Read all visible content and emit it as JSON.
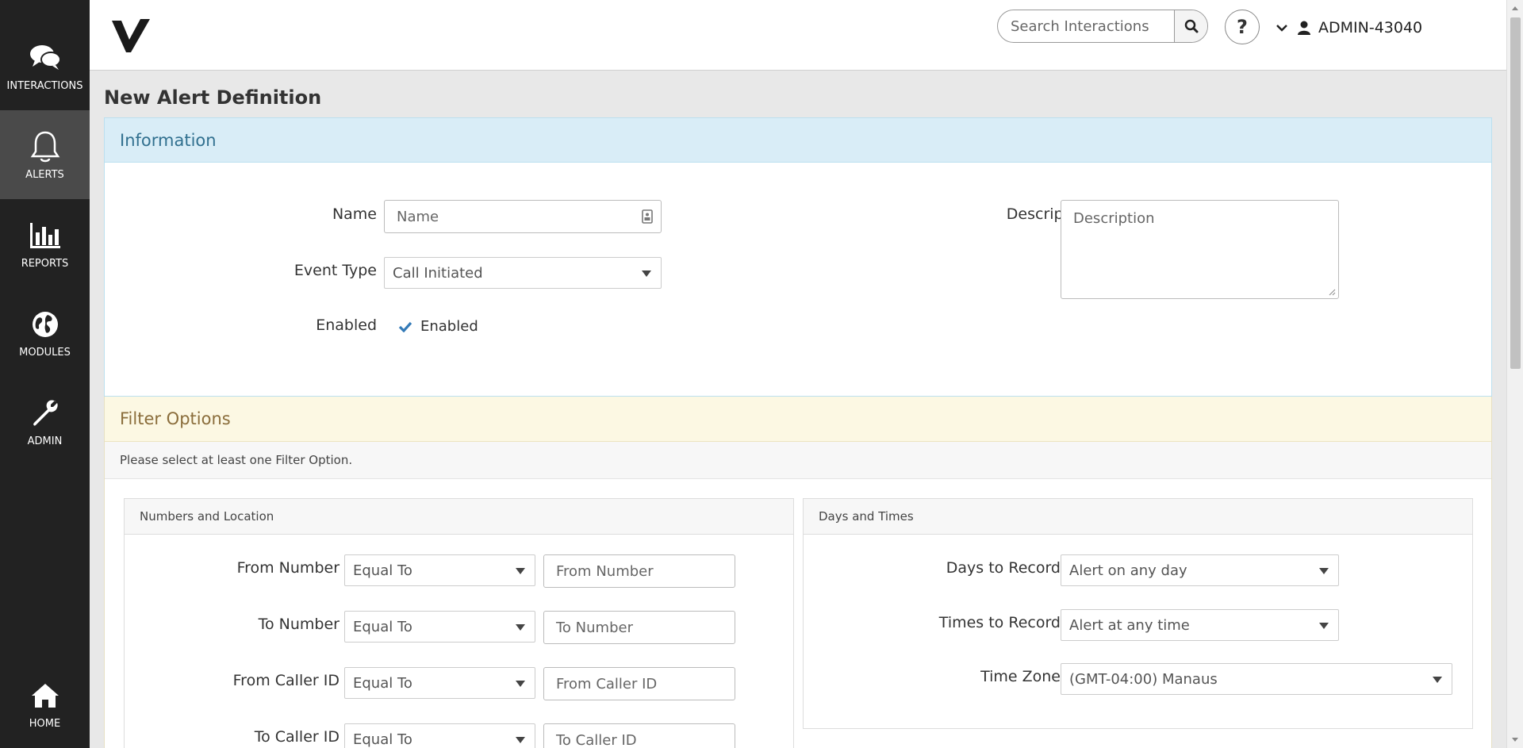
{
  "nav": {
    "interactions": "INTERACTIONS",
    "alerts": "ALERTS",
    "reports": "REPORTS",
    "modules": "MODULES",
    "admin": "ADMIN",
    "home": "HOME"
  },
  "header": {
    "search_placeholder": "Search Interactions",
    "help": "?",
    "user": "ADMIN-43040"
  },
  "page": {
    "title": "New Alert Definition"
  },
  "information": {
    "heading": "Information",
    "name_label": "Name",
    "name_placeholder": "Name",
    "event_type_label": "Event Type",
    "event_type_value": "Call Initiated",
    "enabled_label": "Enabled",
    "enabled_value": "Enabled",
    "description_label": "Description",
    "description_placeholder": "Description"
  },
  "filter": {
    "heading": "Filter Options",
    "note": "Please select at least one Filter Option.",
    "numbers": {
      "heading": "Numbers and Location",
      "rows": [
        {
          "label": "From Number",
          "operator": "Equal To",
          "placeholder": "From Number"
        },
        {
          "label": "To Number",
          "operator": "Equal To",
          "placeholder": "To Number"
        },
        {
          "label": "From Caller ID",
          "operator": "Equal To",
          "placeholder": "From Caller ID"
        },
        {
          "label": "To Caller ID",
          "operator": "Equal To",
          "placeholder": "To Caller ID"
        }
      ]
    },
    "days": {
      "heading": "Days and Times",
      "days_label": "Days to Record",
      "days_value": "Alert on any day",
      "times_label": "Times to Record",
      "times_value": "Alert at any time",
      "tz_label": "Time Zone",
      "tz_value": "(GMT-04:00) Manaus"
    }
  },
  "colors": {
    "sidebar": "#222222",
    "sidebar_active": "#4a4a4a",
    "info_header": "#d9edf7",
    "info_text": "#31708f",
    "filter_header": "#fcf8e3",
    "filter_text": "#8a6d3b",
    "check": "#337ab7"
  }
}
